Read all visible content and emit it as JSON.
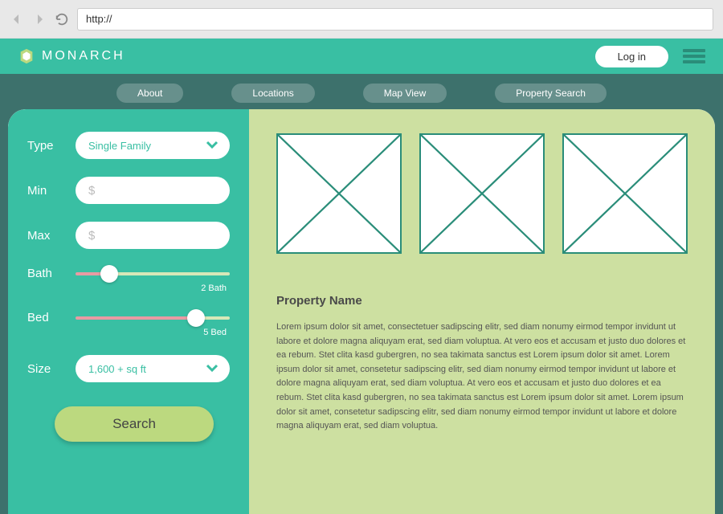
{
  "browser": {
    "url": "http://"
  },
  "header": {
    "brand": "MONARCH",
    "login": "Log in"
  },
  "nav": {
    "items": [
      "About",
      "Locations",
      "Map View",
      "Property Search"
    ]
  },
  "filters": {
    "type": {
      "label": "Type",
      "value": "Single Family"
    },
    "min": {
      "label": "Min",
      "placeholder": "$"
    },
    "max": {
      "label": "Max",
      "placeholder": "$"
    },
    "bath": {
      "label": "Bath",
      "caption": "2 Bath",
      "pct": 22
    },
    "bed": {
      "label": "Bed",
      "caption": "5 Bed",
      "pct": 78
    },
    "size": {
      "label": "Size",
      "value": "1,600 + sq ft"
    },
    "search": "Search"
  },
  "property": {
    "title": "Property Name",
    "body": "Lorem ipsum dolor sit amet, consectetuer sadipscing elitr, sed diam nonumy eirmod tempor invidunt ut labore et dolore magna aliquyam erat, sed diam voluptua. At vero eos et accusam et justo duo dolores et ea rebum. Stet clita kasd gubergren, no sea takimata sanctus est Lorem ipsum dolor sit amet. Lorem ipsum dolor sit amet, consetetur sadipscing elitr, sed diam nonumy eirmod tempor invidunt ut labore et dolore magna aliquyam erat, sed diam voluptua. At vero eos et accusam et justo duo dolores et ea rebum. Stet clita kasd gubergren, no sea takimata sanctus est Lorem ipsum dolor sit amet. Lorem ipsum dolor sit amet, consetetur sadipscing elitr, sed diam nonumy eirmod tempor invidunt ut labore et dolore magna aliquyam erat, sed diam voluptua."
  }
}
